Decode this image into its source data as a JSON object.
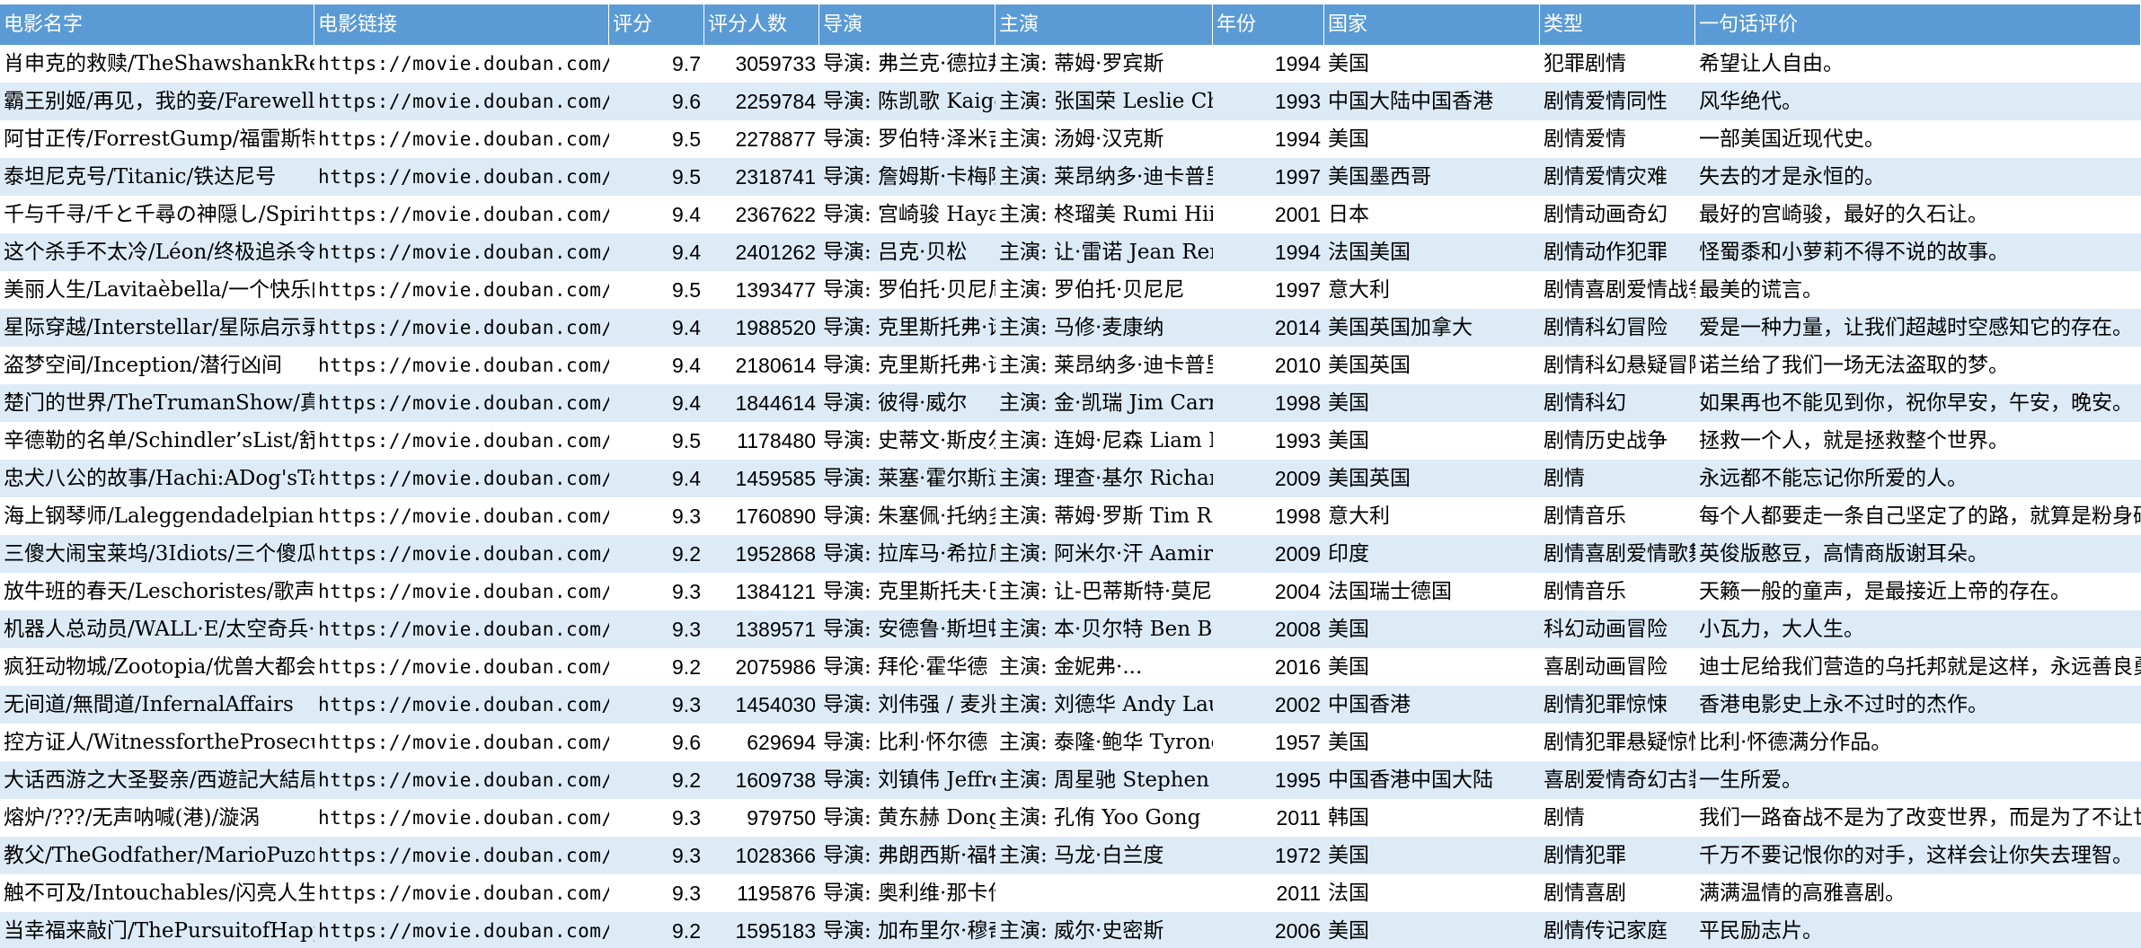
{
  "headers": [
    "电影名字",
    "电影链接",
    "评分",
    "评分人数",
    "导演",
    "主演",
    "年份",
    "国家",
    "类型",
    "一句话评价"
  ],
  "rows": [
    [
      "肖申克的救赎/TheShawshankRedemption",
      "https://movie.douban.com/",
      "9.7",
      "3059733",
      "导演: 弗兰克·德拉邦特",
      "主演: 蒂姆·罗宾斯",
      "1994",
      "美国",
      "犯罪剧情",
      "希望让人自由。"
    ],
    [
      "霸王别姬/再见，我的妾/FarewellMyConcubine",
      "https://movie.douban.com/",
      "9.6",
      "2259784",
      "导演: 陈凯歌 Kaige Chen",
      "主演: 张国荣 Leslie Cheung",
      "1993",
      "中国大陆中国香港",
      "剧情爱情同性",
      "风华绝代。"
    ],
    [
      "阿甘正传/ForrestGump/福雷斯特·冈普",
      "https://movie.douban.com/",
      "9.5",
      "2278877",
      "导演: 罗伯特·泽米吉斯",
      "主演: 汤姆·汉克斯",
      "1994",
      "美国",
      "剧情爱情",
      "一部美国近现代史。"
    ],
    [
      "泰坦尼克号/Titanic/铁达尼号",
      "https://movie.douban.com/",
      "9.5",
      "2318741",
      "导演: 詹姆斯·卡梅隆",
      "主演: 莱昂纳多·迪卡普里奥",
      "1997",
      "美国墨西哥",
      "剧情爱情灾难",
      "失去的才是永恒的。"
    ],
    [
      "千与千寻/千と千尋の神隠し/SpiritedAway",
      "https://movie.douban.com/",
      "9.4",
      "2367622",
      "导演: 宫崎骏 Hayao Miyazaki",
      "主演: 柊瑠美 Rumi Hiiragi",
      "2001",
      "日本",
      "剧情动画奇幻",
      "最好的宫崎骏，最好的久石让。"
    ],
    [
      "这个杀手不太冷/Léon/终极追杀令",
      "https://movie.douban.com/",
      "9.4",
      "2401262",
      "导演: 吕克·贝松",
      "主演: 让·雷诺 Jean Reno",
      "1994",
      "法国美国",
      "剧情动作犯罪",
      "怪蜀黍和小萝莉不得不说的故事。"
    ],
    [
      "美丽人生/Lavitaèbella/一个快乐的传说",
      "https://movie.douban.com/",
      "9.5",
      "1393477",
      "导演: 罗伯托·贝尼尼",
      "主演: 罗伯托·贝尼尼",
      "1997",
      "意大利",
      "剧情喜剧爱情战争",
      "最美的谎言。"
    ],
    [
      "星际穿越/Interstellar/星际启示录",
      "https://movie.douban.com/",
      "9.4",
      "1988520",
      "导演: 克里斯托弗·诺兰",
      "主演: 马修·麦康纳",
      "2014",
      "美国英国加拿大",
      "剧情科幻冒险",
      "爱是一种力量，让我们超越时空感知它的存在。"
    ],
    [
      "盗梦空间/Inception/潜行凶间",
      "https://movie.douban.com/",
      "9.4",
      "2180614",
      "导演: 克里斯托弗·诺兰",
      "主演: 莱昂纳多·迪卡普里奥",
      "2010",
      "美国英国",
      "剧情科幻悬疑冒险",
      "诺兰给了我们一场无法盗取的梦。"
    ],
    [
      "楚门的世界/TheTrumanShow/真人Show",
      "https://movie.douban.com/",
      "9.4",
      "1844614",
      "导演: 彼得·威尔",
      "主演: 金·凯瑞 Jim Carrey",
      "1998",
      "美国",
      "剧情科幻",
      "如果再也不能见到你，祝你早安，午安，晚安。"
    ],
    [
      "辛德勒的名单/Schindler’sList/舒特拉的名单",
      "https://movie.douban.com/",
      "9.5",
      "1178480",
      "导演: 史蒂文·斯皮尔伯格",
      "主演: 连姆·尼森 Liam Neeson",
      "1993",
      "美国",
      "剧情历史战争",
      "拯救一个人，就是拯救整个世界。"
    ],
    [
      "忠犬八公的故事/Hachi:ADog'sTale",
      "https://movie.douban.com/",
      "9.4",
      "1459585",
      "导演: 莱塞·霍尔斯道姆",
      "主演: 理查·基尔 Richard Gere",
      "2009",
      "美国英国",
      "剧情",
      "永远都不能忘记你所爱的人。"
    ],
    [
      "海上钢琴师/Laleggendadelpianista",
      "https://movie.douban.com/",
      "9.3",
      "1760890",
      "导演: 朱塞佩·托纳多雷",
      "主演: 蒂姆·罗斯 Tim Roth",
      "1998",
      "意大利",
      "剧情音乐",
      "每个人都要走一条自己坚定了的路，就算是粉身碎骨。"
    ],
    [
      "三傻大闹宝莱坞/3Idiots/三个傻瓜",
      "https://movie.douban.com/",
      "9.2",
      "1952868",
      "导演: 拉库马·希拉尼",
      "主演: 阿米尔·汗 Aamir Khan",
      "2009",
      "印度",
      "剧情喜剧爱情歌舞",
      "英俊版憨豆，高情商版谢耳朵。"
    ],
    [
      "放牛班的春天/Leschoristes/歌声伴我心",
      "https://movie.douban.com/",
      "9.3",
      "1384121",
      "导演: 克里斯托夫·巴拉蒂",
      "主演: 让-巴蒂斯特·莫尼耶",
      "2004",
      "法国瑞士德国",
      "剧情音乐",
      "天籁一般的童声，是最接近上帝的存在。"
    ],
    [
      "机器人总动员/WALL·E/太空奇兵·威E",
      "https://movie.douban.com/",
      "9.3",
      "1389571",
      "导演: 安德鲁·斯坦顿",
      "主演: 本·贝尔特 Ben Burtt",
      "2008",
      "美国",
      "科幻动画冒险",
      "小瓦力，大人生。"
    ],
    [
      "疯狂动物城/Zootopia/优兽大都会",
      "https://movie.douban.com/",
      "9.2",
      "2075986",
      "导演: 拜伦·霍华德",
      "主演: 金妮弗·...",
      "2016",
      "美国",
      "喜剧动画冒险",
      "迪士尼给我们营造的乌托邦就是这样，永远善良勇敢，永远出乎意料。"
    ],
    [
      "无间道/無間道/InfernalAffairs",
      "https://movie.douban.com/",
      "9.3",
      "1454030",
      "导演: 刘伟强 / 麦兆辉",
      "主演: 刘德华 Andy Lau",
      "2002",
      "中国香港",
      "剧情犯罪惊悚",
      "香港电影史上永不过时的杰作。"
    ],
    [
      "控方证人/WitnessfortheProsecution",
      "https://movie.douban.com/",
      "9.6",
      "629694",
      "导演: 比利·怀尔德",
      "主演: 泰隆·鲍华 Tyrone Power",
      "1957",
      "美国",
      "剧情犯罪悬疑惊悚",
      "比利·怀德满分作品。"
    ],
    [
      "大话西游之大圣娶亲/西遊記大結局之仙履奇緣",
      "https://movie.douban.com/",
      "9.2",
      "1609738",
      "导演: 刘镇伟 Jeffrey Lau",
      "主演: 周星驰 Stephen Chow",
      "1995",
      "中国香港中国大陆",
      "喜剧爱情奇幻古装",
      "一生所爱。"
    ],
    [
      "熔炉/???/无声呐喊(港)/漩涡",
      "https://movie.douban.com/",
      "9.3",
      "979750",
      "导演: 黄东赫 Dong-hyuk Hwang",
      "主演: 孔侑 Yoo Gong",
      "2011",
      "韩国",
      "剧情",
      "我们一路奋战不是为了改变世界，而是为了不让世界改变我们。"
    ],
    [
      "教父/TheGodfather/MarioPuzo'sTheGodfather",
      "https://movie.douban.com/",
      "9.3",
      "1028366",
      "导演: 弗朗西斯·福特·科波拉",
      "主演: 马龙·白兰度",
      "1972",
      "美国",
      "剧情犯罪",
      "千万不要记恨你的对手，这样会让你失去理智。"
    ],
    [
      "触不可及/Intouchables/闪亮人生",
      "https://movie.douban.com/",
      "9.3",
      "1195876",
      "导演: 奥利维·那卡什 Olivier Nakache / 艾力克·托兰达 Eric Toledano   主...",
      "",
      "2011",
      "法国",
      "剧情喜剧",
      "满满温情的高雅喜剧。"
    ],
    [
      "当幸福来敲门/ThePursuitofHappyness",
      "https://movie.douban.com/",
      "9.2",
      "1595183",
      "导演: 加布里尔·穆奇诺",
      "主演: 威尔·史密斯",
      "2006",
      "美国",
      "剧情传记家庭",
      "平民励志片。"
    ]
  ]
}
